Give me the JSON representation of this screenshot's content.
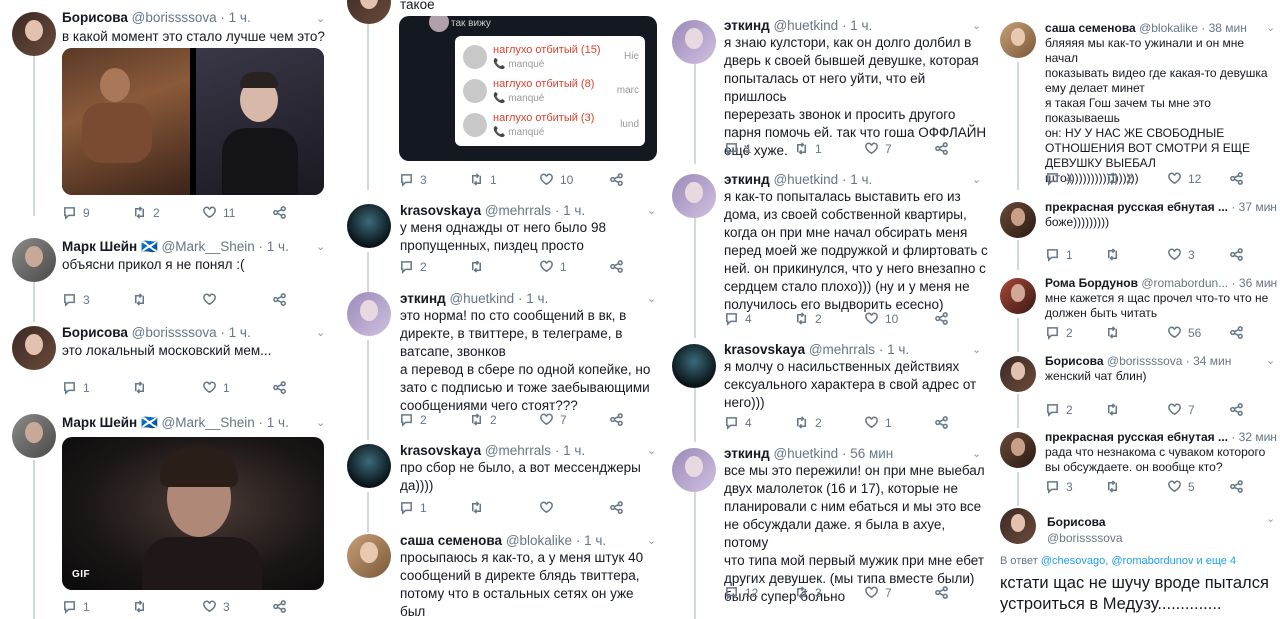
{
  "col1": {
    "t1": {
      "name": "Борисова",
      "handle": "@borissssova",
      "time": "· 1 ч.",
      "text": "в какой момент это стало лучше чем это?",
      "reply": "9",
      "rt": "2",
      "like": "11"
    },
    "t2": {
      "name": "Марк Шейн 🏴󠁧󠁢󠁳󠁣󠁴󠁿",
      "handle": "@Mark__Shein",
      "time": "· 1 ч.",
      "text": "объясни прикол я не понял :(",
      "reply": "3",
      "rt": "",
      "like": ""
    },
    "t3": {
      "name": "Борисова",
      "handle": "@borissssova",
      "time": "· 1 ч.",
      "text": "это локальный московский мем...",
      "reply": "1",
      "rt": "",
      "like": "1"
    },
    "t4": {
      "name": "Марк Шейн 🏴󠁧󠁢󠁳󠁣󠁴󠁿",
      "handle": "@Mark__Shein",
      "time": "· 1 ч.",
      "gif": "GIF",
      "reply": "1",
      "rt": "",
      "like": "3"
    }
  },
  "col2": {
    "top": {
      "text": "такое",
      "caption": "так вижу",
      "calls": [
        {
          "name": "наглухо отбитый (15)",
          "type": "manqué",
          "right": "Hie"
        },
        {
          "name": "наглухо отбитый (8)",
          "type": "manqué",
          "right": "marc"
        },
        {
          "name": "наглухо отбитый (3)",
          "type": "manqué",
          "right": "lund"
        }
      ],
      "reply": "3",
      "rt": "1",
      "like": "10"
    },
    "t1": {
      "name": "krasovskaya",
      "handle": "@mehrrals",
      "time": "· 1 ч.",
      "text": "у меня однажды от него было 98\nпропущенных, пиздец просто",
      "reply": "2",
      "rt": "",
      "like": "1"
    },
    "t2": {
      "name": "эткинд",
      "handle": "@huetkind",
      "time": "· 1 ч.",
      "text": "это норма! по сто сообщений в вк, в\nдиректе, в твиттере, в телеграме, в\nватсапе, звонков\nа перевод в сбере по одной копейке, но\nзато с подписью и тоже заебывающими\nсообщениями чего стоят???",
      "reply": "2",
      "rt": "2",
      "like": "7"
    },
    "t3": {
      "name": "krasovskaya",
      "handle": "@mehrrals",
      "time": "· 1 ч.",
      "text": "про сбор не было, а вот мессенджеры\nда))))",
      "reply": "1",
      "rt": "",
      "like": ""
    },
    "t4": {
      "name": "саша семенова",
      "handle": "@blokalike",
      "time": "· 1 ч.",
      "text": "просыпаюсь я как-то, а у меня штук 40\nсообщений в директе блядь твиттера,\nпотому что в остальных сетях он уже был\nу меня забанен хаха"
    }
  },
  "col3": {
    "t1": {
      "name": "эткинд",
      "handle": "@huetkind",
      "time": "· 1 ч.",
      "text": "я знаю кулстори, как он долго долбил в\nдверь к своей бывшей девушке, которая\nпопыталась от него уйти, что ей пришлось\nперерезать звонок и просить другого\nпарня помочь ей. так что гоша ОФФЛАЙН\nещё хуже.",
      "reply": "1",
      "rt": "1",
      "like": "7"
    },
    "t2": {
      "name": "эткинд",
      "handle": "@huetkind",
      "time": "· 1 ч.",
      "text": "я как-то попыталась выставить его из\nдома, из своей собственной квартиры,\nкогда он при мне начал обсирать меня\nперед моей же подружкой и флиртовать с\nней. он прикинулся, что у него внезапно с\nсердцем стало плохо))) (ну и у меня не\nполучилось его выдворить есесно)",
      "reply": "4",
      "rt": "2",
      "like": "10"
    },
    "t3": {
      "name": "krasovskaya",
      "handle": "@mehrrals",
      "time": "· 1 ч.",
      "text": "я молчу о насильственных действиях\nсексуального характера в свой адрес от\nнего)))",
      "reply": "4",
      "rt": "2",
      "like": "1"
    },
    "t4": {
      "name": "эткинд",
      "handle": "@huetkind",
      "time": "· 56 мин",
      "text": "все мы это пережили! он при мне выебал\nдвух малолеток (16 и 17), которые не\nпланировали с ним ебаться и мы это все\nне обсуждали даже. я была в ахуе, потому\nчто типа мой первый мужик при мне ебет\nдругих девушек. (мы типа вместе были)\nбыло супер больно",
      "reply": "12",
      "rt": "3",
      "like": "7"
    }
  },
  "col4": {
    "t1": {
      "name": "саша семенова",
      "handle": "@blokalike",
      "time": "· 38 мин",
      "text": "бляяяя мы как-то ужинали и он мне начал\nпоказывать видео где какая-то девушка\nему делает минет\nя такая Гош зачем ты мне это\nпоказываешь\nон: НУ У НАС ЖЕ СВОБОДНЫЕ\nОТНОШЕНИЯ ВОТ СМОТРИ Я ЕЩЕ\nДЕВУШКУ ВЫЕБАЛ\nшто))))))))))))))))))",
      "reply": "4",
      "rt": "2",
      "like": "12"
    },
    "t2": {
      "name": "прекрасная русская ебнутая ...",
      "handle": "",
      "time": "· 37 мин",
      "text": "боже)))))))))",
      "reply": "1",
      "rt": "",
      "like": "3"
    },
    "t3": {
      "name": "Рома Бордунов",
      "handle": "@romabordun...",
      "time": "· 36 мин",
      "text": "мне кажется я щас прочел что-то что не\nдолжен быть читать",
      "reply": "2",
      "rt": "",
      "like": "56"
    },
    "t4": {
      "name": "Борисова",
      "handle": "@borissssova",
      "time": "· 34 мин",
      "text": "женский чат блин)",
      "reply": "2",
      "rt": "",
      "like": "7"
    },
    "t5": {
      "name": "прекрасная русская ебнутая ...",
      "handle": "",
      "time": "· 32 мин",
      "text": "рада что незнакома с чуваком которого\nвы обсуждаете. он вообще кто?",
      "reply": "3",
      "rt": "",
      "like": "5"
    },
    "t6": {
      "name": "Борисова",
      "handle": "@borissssova",
      "reply_prefix": "В ответ",
      "reply_to": "@chesovago, @romabordunov и еще 4",
      "text": "кстати щас не шучу вроде пытался\nустроиться в Медузу.............."
    }
  }
}
